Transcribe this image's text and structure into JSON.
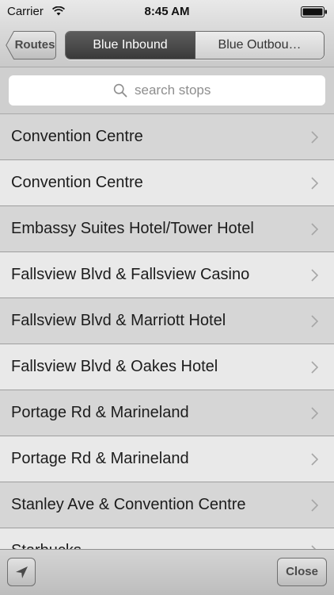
{
  "status_bar": {
    "carrier": "Carrier",
    "time": "8:45 AM",
    "wifi_icon": "wifi-icon",
    "battery_icon": "battery-icon"
  },
  "nav": {
    "back_label": "Routes",
    "segments": [
      {
        "label": "Blue Inbound",
        "selected": true
      },
      {
        "label": "Blue Outbou…",
        "selected": false
      }
    ]
  },
  "search": {
    "placeholder": "search stops",
    "icon": "search-icon"
  },
  "stops": [
    {
      "label": "Convention Centre"
    },
    {
      "label": "Convention Centre"
    },
    {
      "label": "Embassy Suites Hotel/Tower Hotel"
    },
    {
      "label": "Fallsview Blvd & Fallsview Casino"
    },
    {
      "label": "Fallsview Blvd & Marriott Hotel"
    },
    {
      "label": "Fallsview Blvd & Oakes Hotel"
    },
    {
      "label": "Portage Rd & Marineland"
    },
    {
      "label": "Portage Rd & Marineland"
    },
    {
      "label": "Stanley Ave & Convention Centre"
    },
    {
      "label": "Starbucks"
    }
  ],
  "toolbar": {
    "location_icon": "location-arrow-icon",
    "close_label": "Close"
  },
  "colors": {
    "selected_segment": "#4a4a4a",
    "row_dark": "#d6d6d6",
    "row_light": "#e9e9e9",
    "placeholder": "#8e8e8e"
  }
}
